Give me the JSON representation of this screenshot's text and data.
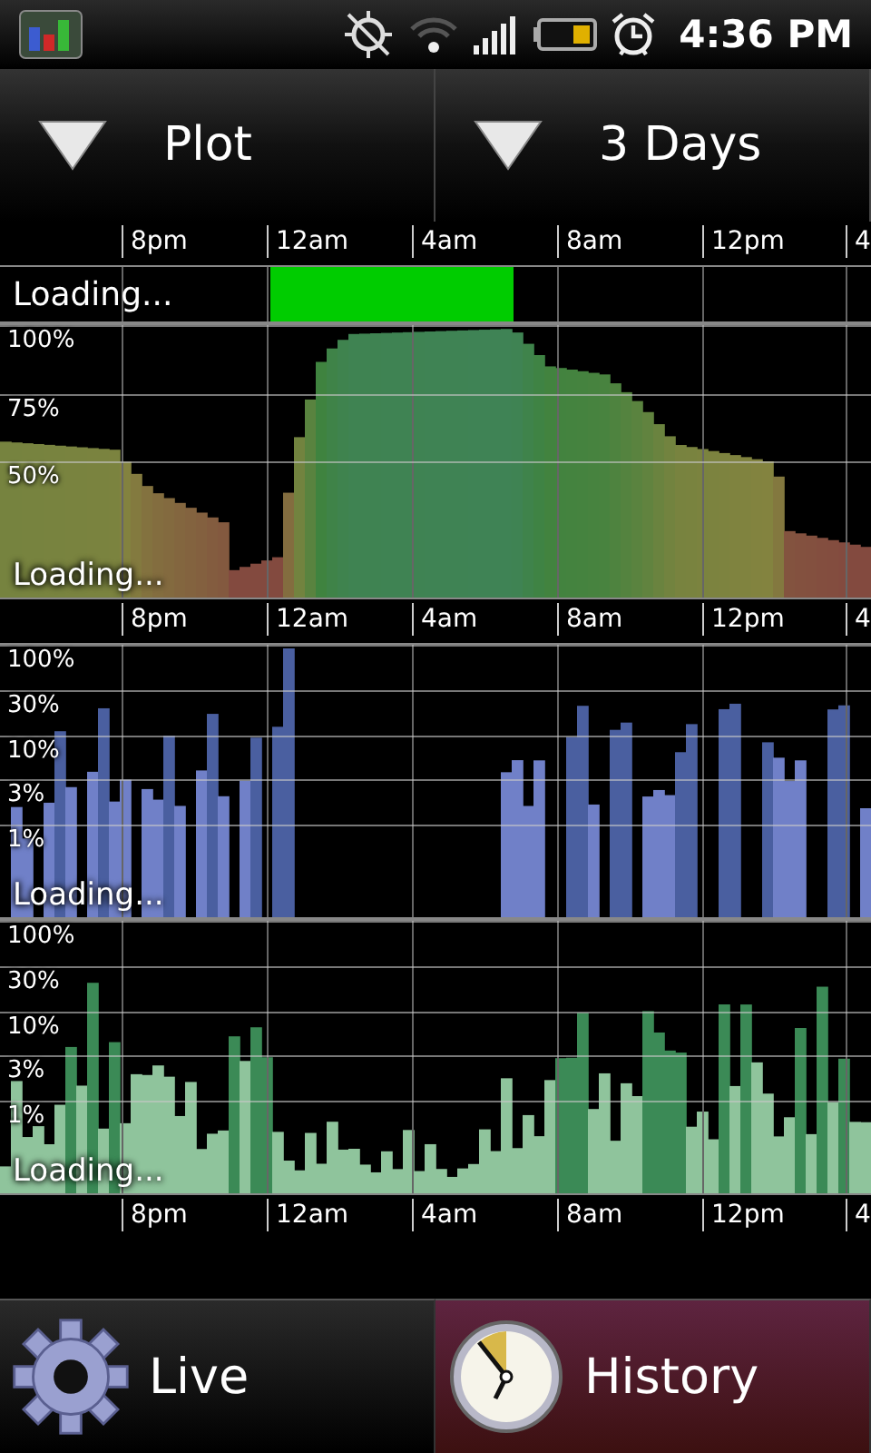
{
  "status_bar": {
    "time": "4:36 PM"
  },
  "selectors": [
    {
      "label": "Plot"
    },
    {
      "label": "3 Days"
    }
  ],
  "time_axes": [
    {
      "ticks": [
        "8pm",
        "12am",
        "4am",
        "8am",
        "12pm",
        "4"
      ]
    },
    {
      "ticks": [
        "8pm",
        "12am",
        "4am",
        "8am",
        "12pm",
        "4"
      ]
    },
    {
      "ticks": [
        "8pm",
        "12am",
        "4am",
        "8am",
        "12pm",
        "4"
      ]
    }
  ],
  "loading_row": {
    "status": "Loading..."
  },
  "plots": [
    {
      "kind": "area",
      "y_labels": [
        "100%",
        "75%",
        "50%"
      ],
      "status": "Loading..."
    },
    {
      "kind": "blue_bars",
      "y_labels": [
        "100%",
        "30%",
        "10%",
        "3%",
        "1%"
      ],
      "status": "Loading..."
    },
    {
      "kind": "green_bars",
      "y_labels": [
        "100%",
        "30%",
        "10%",
        "3%",
        "1%"
      ],
      "status": "Loading..."
    }
  ],
  "tabs": [
    {
      "label": "Live",
      "selected": false
    },
    {
      "label": "History",
      "selected": true
    }
  ]
}
